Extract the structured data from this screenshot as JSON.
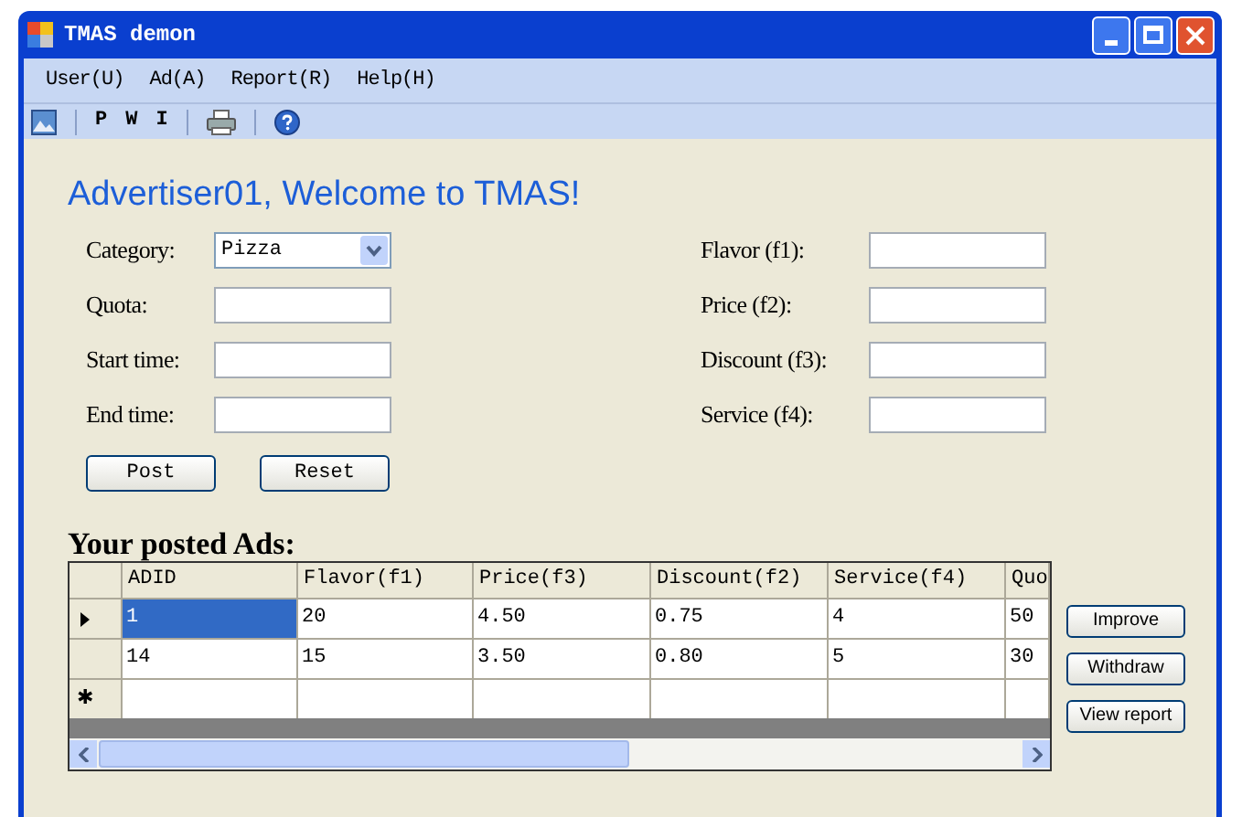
{
  "window": {
    "title": "TMAS demon"
  },
  "menu": [
    "User(U)",
    "Ad(A)",
    "Report(R)",
    "Help(H)"
  ],
  "toolbar": [
    {
      "kind": "image"
    },
    {
      "kind": "text",
      "label": "P"
    },
    {
      "kind": "text",
      "label": "W"
    },
    {
      "kind": "text",
      "label": "I"
    },
    {
      "kind": "print"
    },
    {
      "kind": "help"
    }
  ],
  "heading": "Advertiser01, Welcome to TMAS!",
  "left_fields": [
    {
      "label": "Category:",
      "kind": "dropdown",
      "value": "Pizza"
    },
    {
      "label": "Quota:",
      "kind": "text"
    },
    {
      "label": "Start time:",
      "kind": "text"
    },
    {
      "label": "End time:",
      "kind": "text"
    }
  ],
  "right_fields": [
    {
      "label": "Flavor (f1):",
      "kind": "text"
    },
    {
      "label": "Price (f2):",
      "kind": "text"
    },
    {
      "label": "Discount (f3):",
      "kind": "text"
    },
    {
      "label": "Service (f4):",
      "kind": "text"
    }
  ],
  "form_buttons": [
    "Post",
    "Reset"
  ],
  "ads_title": "Your posted Ads:",
  "table": {
    "columns": [
      "ADID",
      "Flavor(f1)",
      "Price(f3)",
      "Discount(f2)",
      "Service(f4)",
      "Quo"
    ],
    "rows": [
      {
        "selected": true,
        "cells": [
          "1",
          "20",
          "4.50",
          "0.75",
          "4",
          "50"
        ]
      },
      {
        "selected": false,
        "cells": [
          "14",
          "15",
          "3.50",
          "0.80",
          "5",
          "30"
        ]
      }
    ],
    "new_row_marker": "✱"
  },
  "side_buttons": [
    "Improve",
    "Withdraw",
    "View report"
  ]
}
